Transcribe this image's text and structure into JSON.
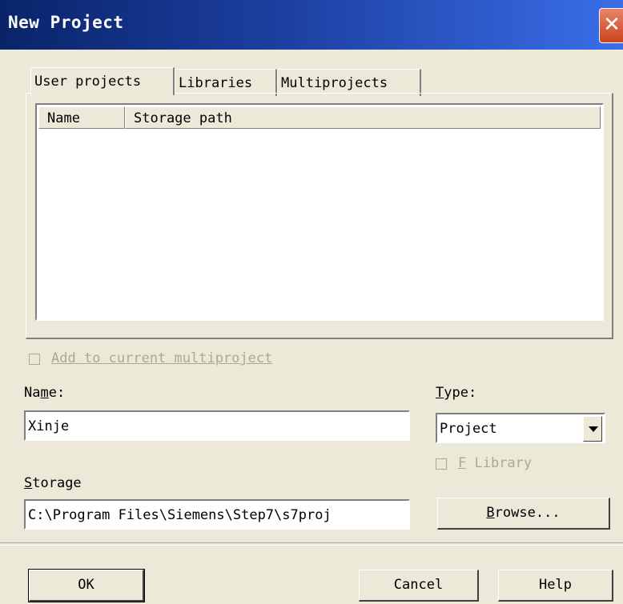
{
  "window": {
    "title": "New Project",
    "close_symbol": "✕"
  },
  "tabs": [
    "User projects",
    "Libraries",
    "Multiprojects"
  ],
  "list": {
    "columns": [
      "Name",
      "Storage path"
    ],
    "rows": []
  },
  "add_to_multiproject": {
    "label": "Add to current multiproject",
    "checked": false,
    "enabled": false
  },
  "name": {
    "label_pre": "Na",
    "label_u": "m",
    "label_post": "e:",
    "value": "Xinje"
  },
  "type": {
    "label_u": "T",
    "label_post": "ype:",
    "value": "Project"
  },
  "f_library": {
    "label_u": "F",
    "label_post": " Library",
    "checked": false,
    "enabled": false
  },
  "storage": {
    "label_u": "S",
    "label_post": "torage",
    "value": "C:\\Program Files\\Siemens\\Step7\\s7proj"
  },
  "buttons": {
    "browse_u": "B",
    "browse_post": "rowse...",
    "ok": "OK",
    "cancel": "Cancel",
    "help": "Help"
  }
}
